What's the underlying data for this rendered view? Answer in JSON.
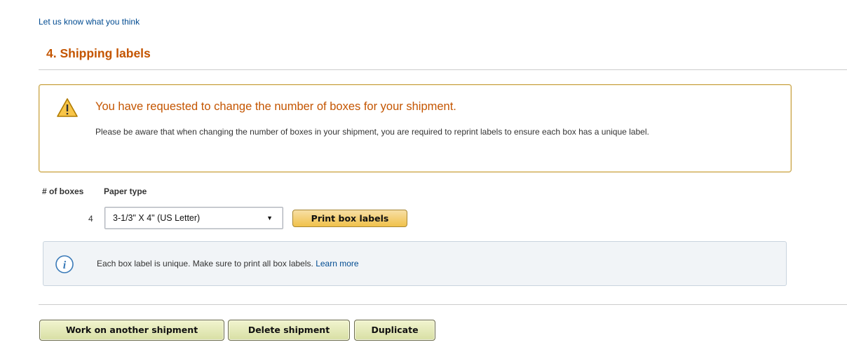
{
  "header": {
    "feedback_link": "Let us know what you think",
    "section_title": "4. Shipping labels"
  },
  "alert": {
    "icon": "warning-icon",
    "heading": "You have requested to change the number of boxes for your shipment.",
    "body": "Please be aware that when changing the number of boxes in your shipment, you are required to reprint labels to ensure each box has a unique label."
  },
  "labels_form": {
    "boxes_header": "# of boxes",
    "paper_header": "Paper type",
    "box_count": "4",
    "paper_type_selected": "3-1/3\" X 4\" (US Letter)",
    "print_button": "Print box labels"
  },
  "info": {
    "icon": "info-icon",
    "text": "Each box label is unique. Make sure to print all box labels.",
    "link": "Learn more"
  },
  "actions": {
    "work_on_another": "Work on another shipment",
    "delete": "Delete shipment",
    "duplicate": "Duplicate"
  },
  "colors": {
    "section_title": "#c45500",
    "link": "#004b91",
    "alert_border": "#c8a44a",
    "info_background": "#f1f4f7",
    "primary_button": "#f0c14b",
    "secondary_button": "#d8dfa4"
  }
}
